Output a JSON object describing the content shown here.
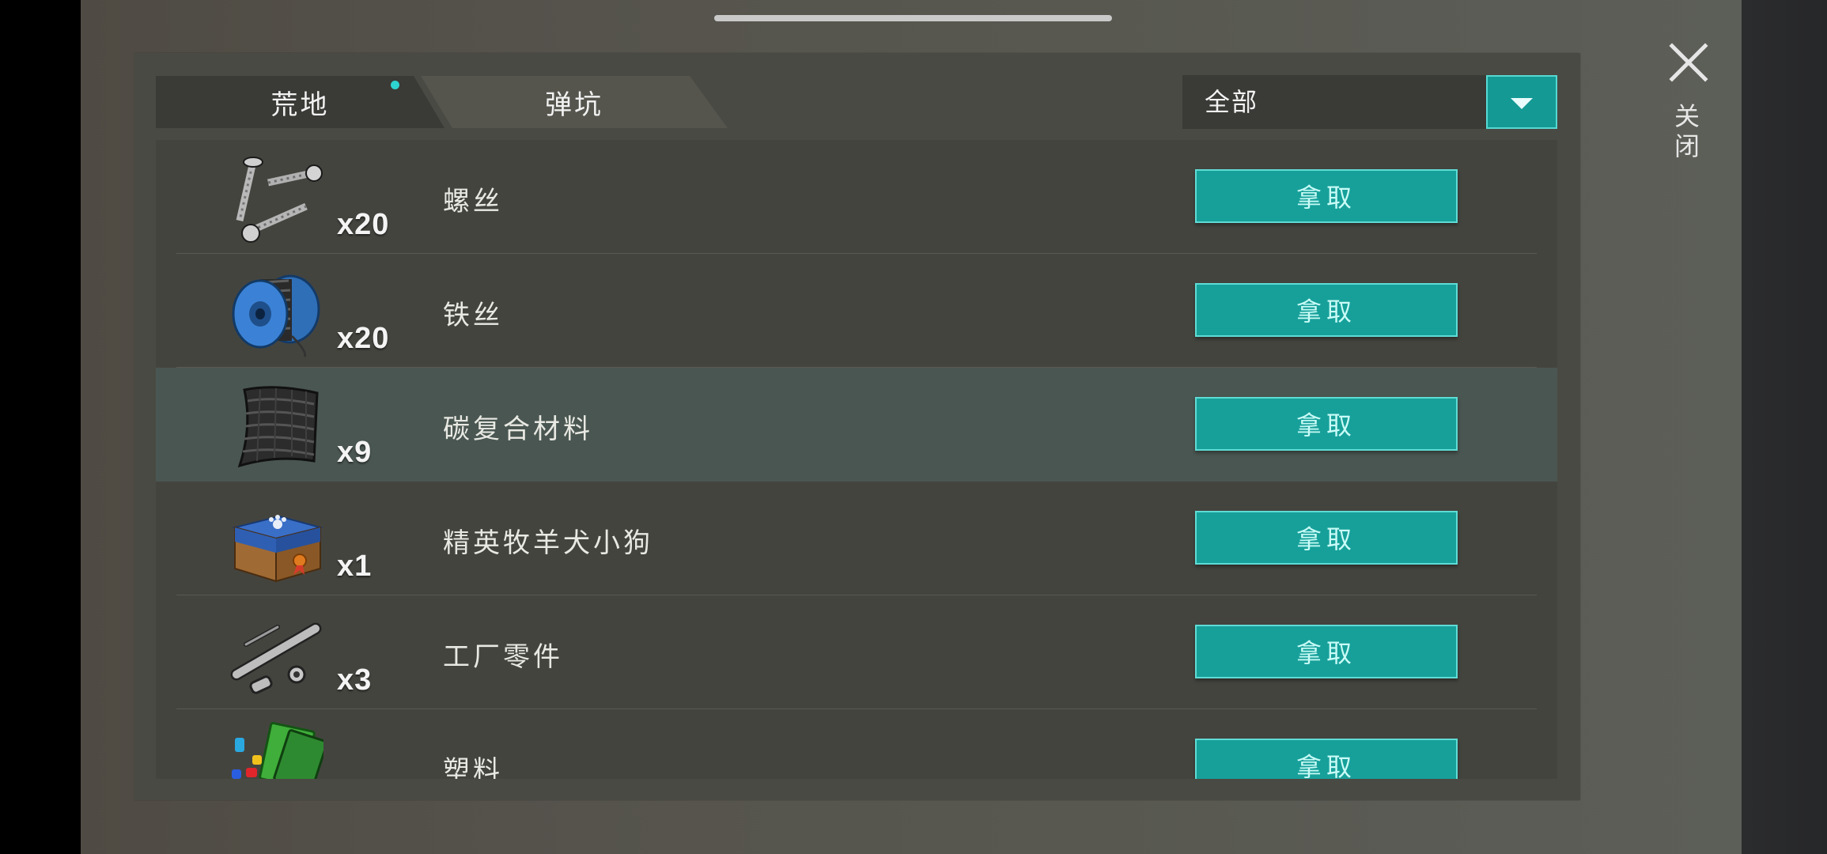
{
  "tabs": [
    {
      "label": "荒地",
      "active": true,
      "has_notification": true
    },
    {
      "label": "弹坑",
      "active": false
    }
  ],
  "filter": {
    "selected": "全部"
  },
  "close": {
    "label": "关闭"
  },
  "items": [
    {
      "name": "螺丝",
      "quantity": "x20",
      "icon": "screws-icon",
      "button_label": "拿取",
      "highlighted": false
    },
    {
      "name": "铁丝",
      "quantity": "x20",
      "icon": "wire-spool-icon",
      "button_label": "拿取",
      "highlighted": false
    },
    {
      "name": "碳复合材料",
      "quantity": "x9",
      "icon": "carbon-composite-icon",
      "button_label": "拿取",
      "highlighted": true
    },
    {
      "name": "精英牧羊犬小狗",
      "quantity": "x1",
      "icon": "dog-box-icon",
      "button_label": "拿取",
      "highlighted": false
    },
    {
      "name": "工厂零件",
      "quantity": "x3",
      "icon": "factory-parts-icon",
      "button_label": "拿取",
      "highlighted": false
    },
    {
      "name": "塑料",
      "quantity": "",
      "icon": "plastic-icon",
      "button_label": "拿取",
      "highlighted": false
    }
  ],
  "colors": {
    "accent": "#17a09a",
    "accent_border": "#5fdcd5",
    "notification_dot": "#2dd3cf"
  }
}
